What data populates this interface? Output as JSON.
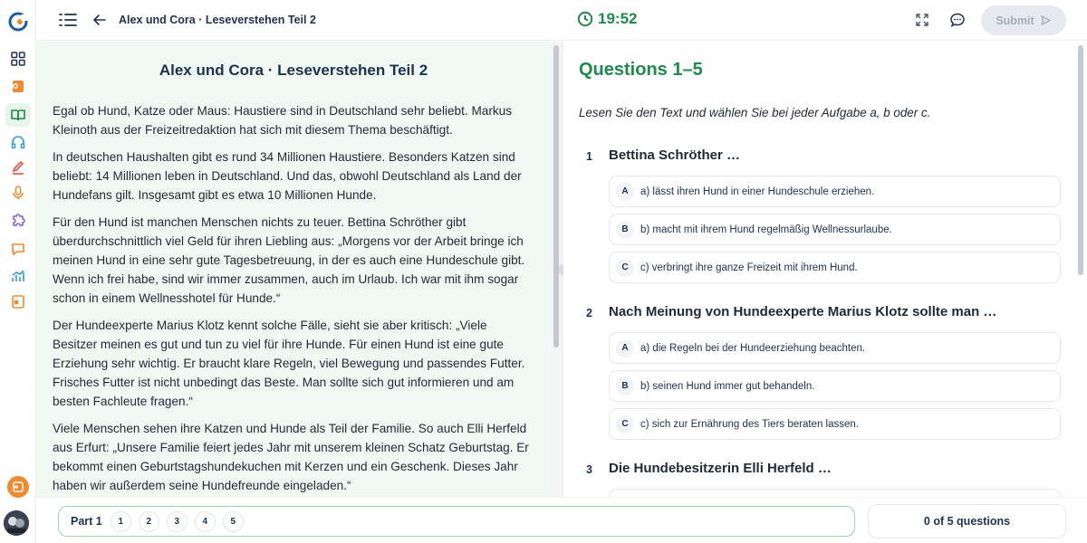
{
  "header": {
    "title": "Alex und Cora · Leseverstehen Teil 2",
    "timer": "19:52",
    "submit_label": "Submit"
  },
  "sidebar": {
    "items": [
      {
        "icon": "dashboard-icon"
      },
      {
        "icon": "notes-icon"
      },
      {
        "icon": "book-icon",
        "active": true
      },
      {
        "icon": "headphones-icon"
      },
      {
        "icon": "pencil-icon"
      },
      {
        "icon": "microphone-icon"
      },
      {
        "icon": "puzzle-icon"
      },
      {
        "icon": "chat-bubble-icon"
      },
      {
        "icon": "stats-icon"
      },
      {
        "icon": "document-icon"
      }
    ],
    "accent": "#f08a2c",
    "active_color": "#1e8a4c"
  },
  "reading": {
    "title": "Alex und Cora · Leseverstehen Teil 2",
    "paragraphs": [
      "Egal ob Hund, Katze oder Maus: Haustiere sind in Deutschland sehr beliebt. Markus Kleinoth aus der Freizeitredaktion hat sich mit diesem Thema beschäftigt.",
      "In deutschen Haushalten gibt es rund 34 Millionen Haustiere. Besonders Katzen sind beliebt: 14 Millionen leben in Deutschland. Und das, obwohl Deutschland als Land der Hundefans gilt. Insgesamt gibt es etwa 10 Millionen Hunde.",
      "Für den Hund ist manchen Menschen nichts zu teuer. Bettina Schröther gibt überdurchschnittlich viel Geld für ihren Liebling aus: „Morgens vor der Arbeit bringe ich meinen Hund in eine sehr gute Tagesbetreuung, in der es auch eine Hundeschule gibt. Wenn ich frei habe, sind wir immer zusammen, auch im Urlaub. Ich war mit ihm sogar schon in einem Wellnesshotel für Hunde.“",
      "Der Hundeexperte Marius Klotz kennt solche Fälle, sieht sie aber kritisch: „Viele Besitzer meinen es gut und tun zu viel für ihre Hunde. Für einen Hund ist eine gute Erziehung sehr wichtig. Er braucht klare Regeln, viel Bewegung und passendes Futter. Frisches Futter ist nicht unbedingt das Beste. Man sollte sich gut informieren und am besten Fachleute fragen.“",
      "Viele Menschen sehen ihre Katzen und Hunde als Teil der Familie. So auch Elli Herfeld aus Erfurt: „Unsere Familie feiert jedes Jahr mit unserem kleinen Schatz Geburtstag. Er bekommt einen Geburtstagshundekuchen mit Kerzen und ein Geschenk. Dieses Jahr haben wir außerdem seine Hundefreunde eingeladen.“"
    ]
  },
  "questions": {
    "heading": "Questions 1–5",
    "instruction": "Lesen Sie den Text und wählen Sie bei jeder Aufgabe a, b oder c.",
    "items": [
      {
        "number": "1",
        "text": "Bettina Schröther …",
        "options": [
          {
            "badge": "A",
            "text": "a) lässt ihren Hund in einer Hundeschule erziehen."
          },
          {
            "badge": "B",
            "text": "b) macht mit ihrem Hund regelmäßig Wellnessurlaube."
          },
          {
            "badge": "C",
            "text": "c) verbringt ihre ganze Freizeit mit ihrem Hund."
          }
        ]
      },
      {
        "number": "2",
        "text": "Nach Meinung von Hundeexperte Marius Klotz sollte man …",
        "options": [
          {
            "badge": "A",
            "text": "a) die Regeln bei der Hundeerziehung beachten."
          },
          {
            "badge": "B",
            "text": "b) seinen Hund immer gut behandeln."
          },
          {
            "badge": "C",
            "text": "c) sich zur Ernährung des Tiers beraten lassen."
          }
        ]
      },
      {
        "number": "3",
        "text": "Die Hundebesitzerin Elli Herfeld …",
        "options": []
      }
    ]
  },
  "footer": {
    "part_label": "Part 1",
    "chips": [
      "1",
      "2",
      "3",
      "4",
      "5"
    ],
    "progress_text": "0 of 5 questions"
  },
  "colors": {
    "brand_green": "#1e8a4c",
    "reading_bg": "#eff8f1",
    "submit_disabled_bg": "#e6eaf0"
  }
}
